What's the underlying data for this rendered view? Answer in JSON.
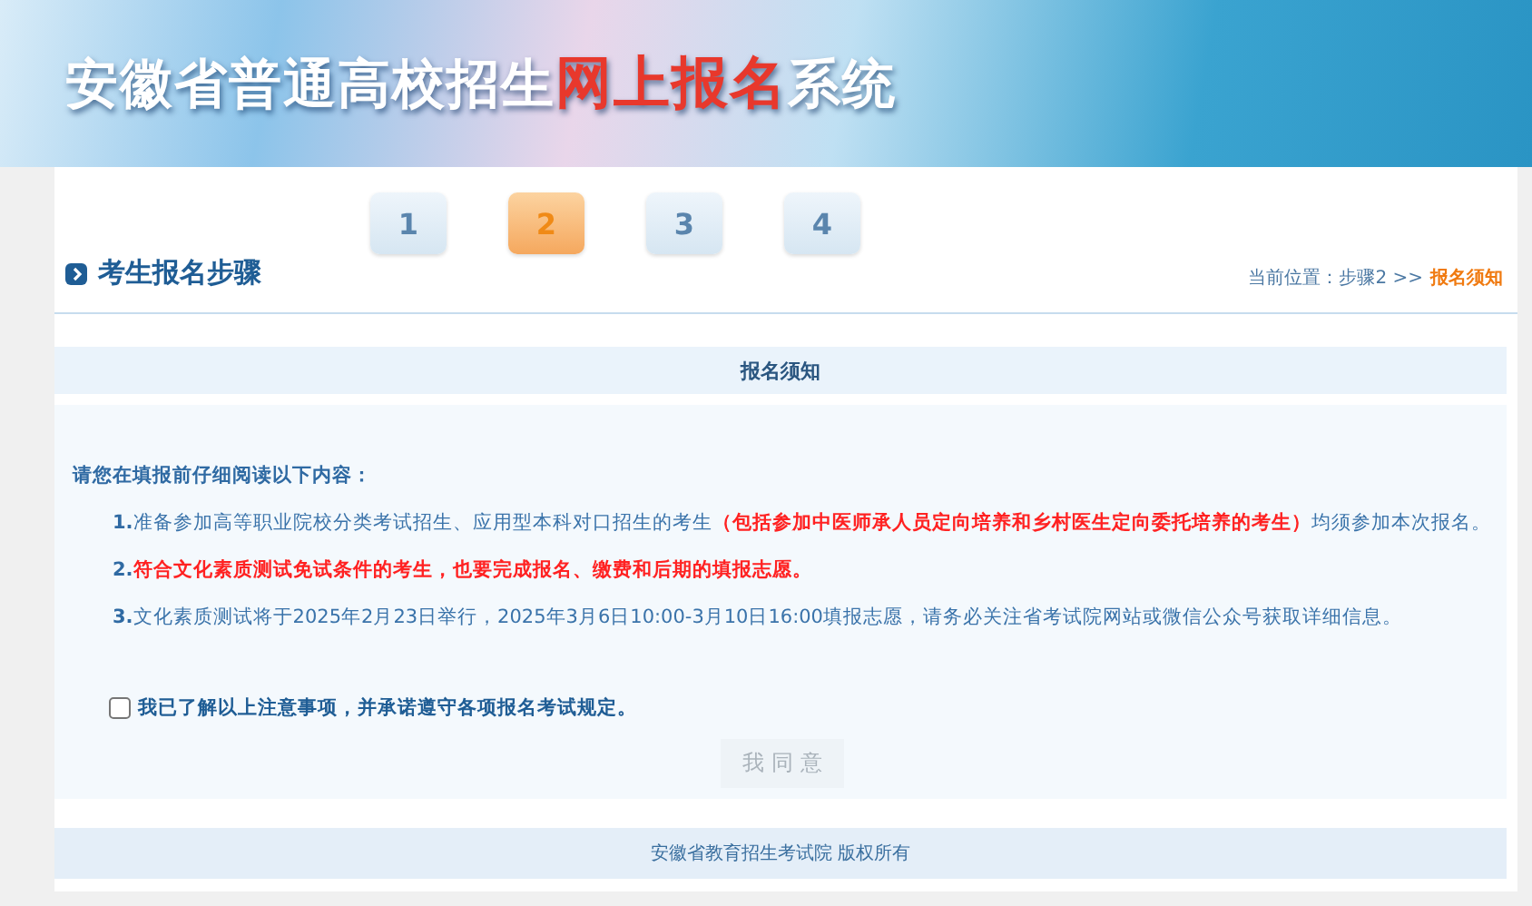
{
  "banner": {
    "title": [
      {
        "text": "安徽省普通高校招生",
        "highlight": false
      },
      {
        "text": "网上报名",
        "highlight": true
      },
      {
        "text": "系统",
        "highlight": false
      }
    ]
  },
  "steps": {
    "heading": "考生报名步骤",
    "items": [
      {
        "label": "1",
        "selected": false
      },
      {
        "label": "2",
        "selected": true
      },
      {
        "label": "3",
        "selected": false
      },
      {
        "label": "4",
        "selected": false
      }
    ],
    "breadcrumb": {
      "prefix": "当前位置：步骤2 >>",
      "current": "报名须知"
    }
  },
  "notice": {
    "title": "报名须知",
    "intro": "请您在填报前仔细阅读以下内容：",
    "items": [
      {
        "number": "1.",
        "segments": [
          {
            "text": "准备参加高等职业院校分类考试招生、应用型本科对口招生的考生",
            "highlight": false
          },
          {
            "text": "（包括参加中医师承人员定向培养和乡村医生定向委托培养的考生）",
            "highlight": true
          },
          {
            "text": "均须参加本次报名。",
            "highlight": false
          }
        ]
      },
      {
        "number": "2.",
        "segments": [
          {
            "text": "符合文化素质测试免试条件的考生，也要完成报名、缴费和后期的填报志愿。",
            "highlight": true
          }
        ]
      },
      {
        "number": "3.",
        "segments": [
          {
            "text": "文化素质测试将于2025年2月23日举行，2025年3月6日10:00-3月10日16:00填报志愿，请务必关注省考试院网站或微信公众号获取详细信息。",
            "highlight": false
          }
        ]
      }
    ],
    "agreement": {
      "label": "我已了解以上注意事项，并承诺遵守各项报名考试规定。",
      "checked": false
    },
    "button": {
      "label": "我 同 意",
      "disabled": true
    }
  },
  "footer": "安徽省教育招生考试院 版权所有"
}
